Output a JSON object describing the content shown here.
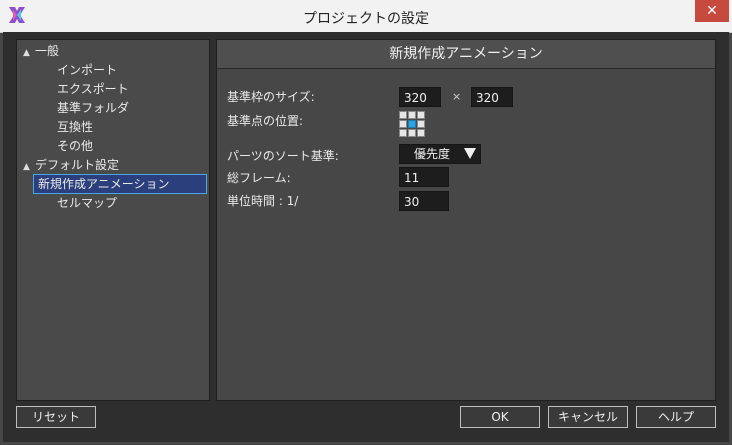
{
  "window": {
    "title": "プロジェクトの設定",
    "close_glyph": "✕"
  },
  "tree": {
    "items": [
      {
        "label": "一般",
        "expanded": true
      },
      {
        "label": "インポート"
      },
      {
        "label": "エクスポート"
      },
      {
        "label": "基準フォルダ"
      },
      {
        "label": "互換性"
      },
      {
        "label": "その他"
      },
      {
        "label": "デフォルト設定",
        "expanded": true
      },
      {
        "label": "新規作成アニメーション",
        "selected": true
      },
      {
        "label": "セルマップ"
      }
    ]
  },
  "panel": {
    "title": "新規作成アニメーション",
    "frame_size_label": "基準枠のサイズ:",
    "width": "320",
    "times": "×",
    "height": "320",
    "pivot_label": "基準点の位置:",
    "pivot_selected": "center",
    "sort_label": "パーツのソート基準:",
    "sort_value": "優先度",
    "total_frames_label": "総フレーム:",
    "total_frames": "11",
    "unit_time_label": "単位時間 : 1/",
    "unit_time": "30"
  },
  "buttons": {
    "reset": "リセット",
    "ok": "OK",
    "cancel": "キャンセル",
    "help": "ヘルプ"
  },
  "colors": {
    "accent": "#2ea3e4",
    "selection_bg": "#2a3f7c",
    "close_bg": "#c74a3e"
  }
}
